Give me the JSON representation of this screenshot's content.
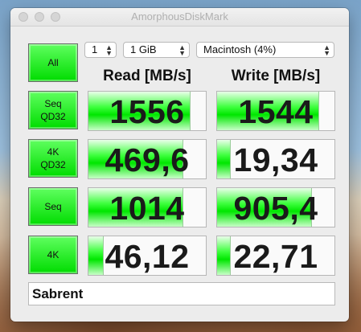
{
  "window": {
    "title": "AmorphousDiskMark"
  },
  "controls": {
    "count": "1",
    "size": "1 GiB",
    "target": "Macintosh (4%)"
  },
  "headers": {
    "read": "Read [MB/s]",
    "write": "Write [MB/s]"
  },
  "all_button": "All",
  "rows": [
    {
      "label_line1": "Seq",
      "label_line2": "QD32",
      "read": "1556",
      "write": "1544",
      "read_fill": 0.86,
      "write_fill": 0.86
    },
    {
      "label_line1": "4K",
      "label_line2": "QD32",
      "read": "469,6",
      "write": "19,34",
      "read_fill": 0.8,
      "write_fill": 0.11
    },
    {
      "label_line1": "Seq",
      "label_line2": "",
      "read": "1014",
      "write": "905,4",
      "read_fill": 0.8,
      "write_fill": 0.8
    },
    {
      "label_line1": "4K",
      "label_line2": "",
      "read": "46,12",
      "write": "22,71",
      "read_fill": 0.12,
      "write_fill": 0.11
    }
  ],
  "comment": "Sabrent",
  "colors": {
    "accent": "#00e600",
    "button": "#3cff3c"
  }
}
